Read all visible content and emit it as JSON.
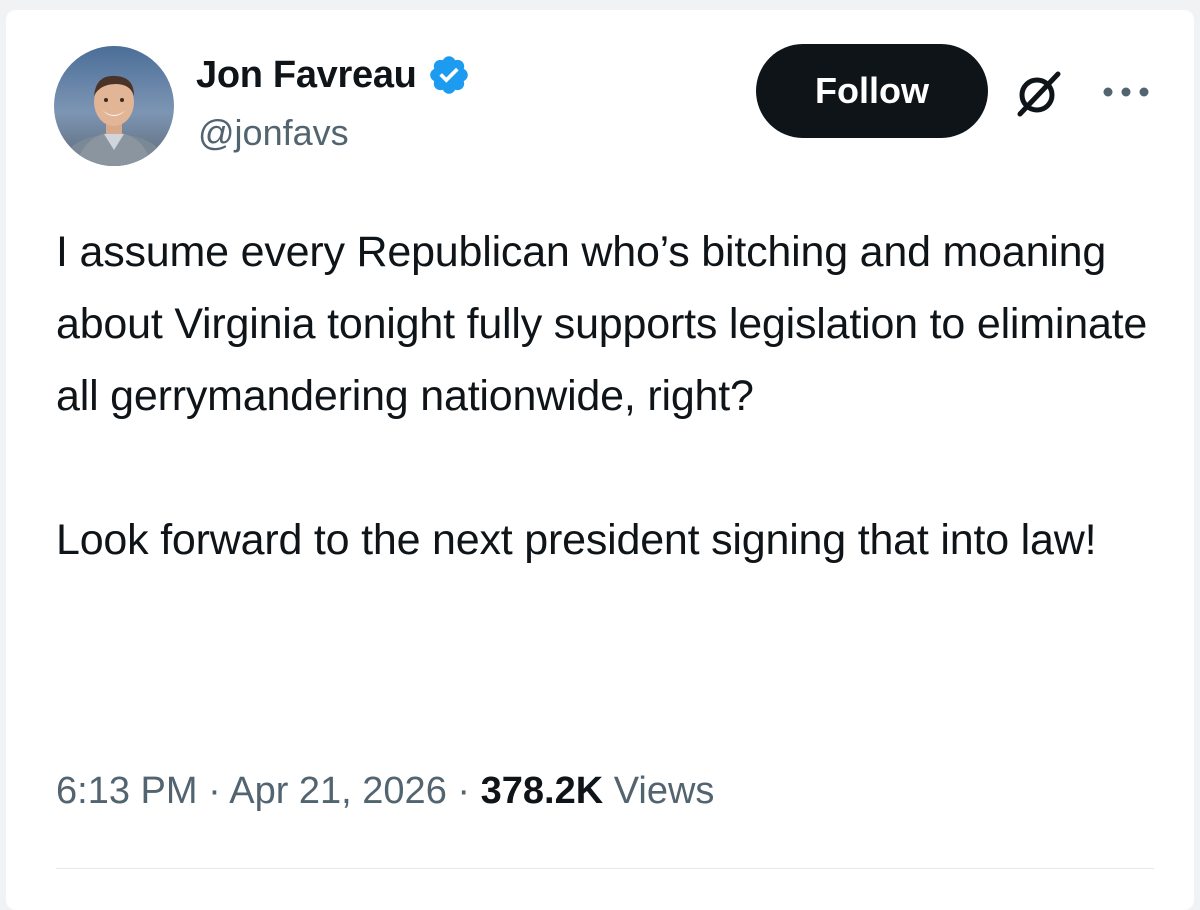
{
  "author": {
    "display_name": "Jon Favreau",
    "handle": "@jonfavs",
    "verified_icon": "verified-badge-icon",
    "badge_color": "#1d9bf0"
  },
  "actions": {
    "follow_label": "Follow",
    "grok_icon": "grok-slash-icon",
    "more_icon": "more-dots-icon"
  },
  "tweet": {
    "paragraphs": [
      "I assume every Republican who’s bitching and moaning about Virginia tonight fully supports legislation to eliminate all gerrymandering nationwide, right?",
      "Look forward to the next president signing that into law!"
    ]
  },
  "meta": {
    "time": "6:13 PM",
    "separator": " · ",
    "date": "Apr 21, 2026",
    "views_count": "378.2K",
    "views_label": "Views"
  }
}
